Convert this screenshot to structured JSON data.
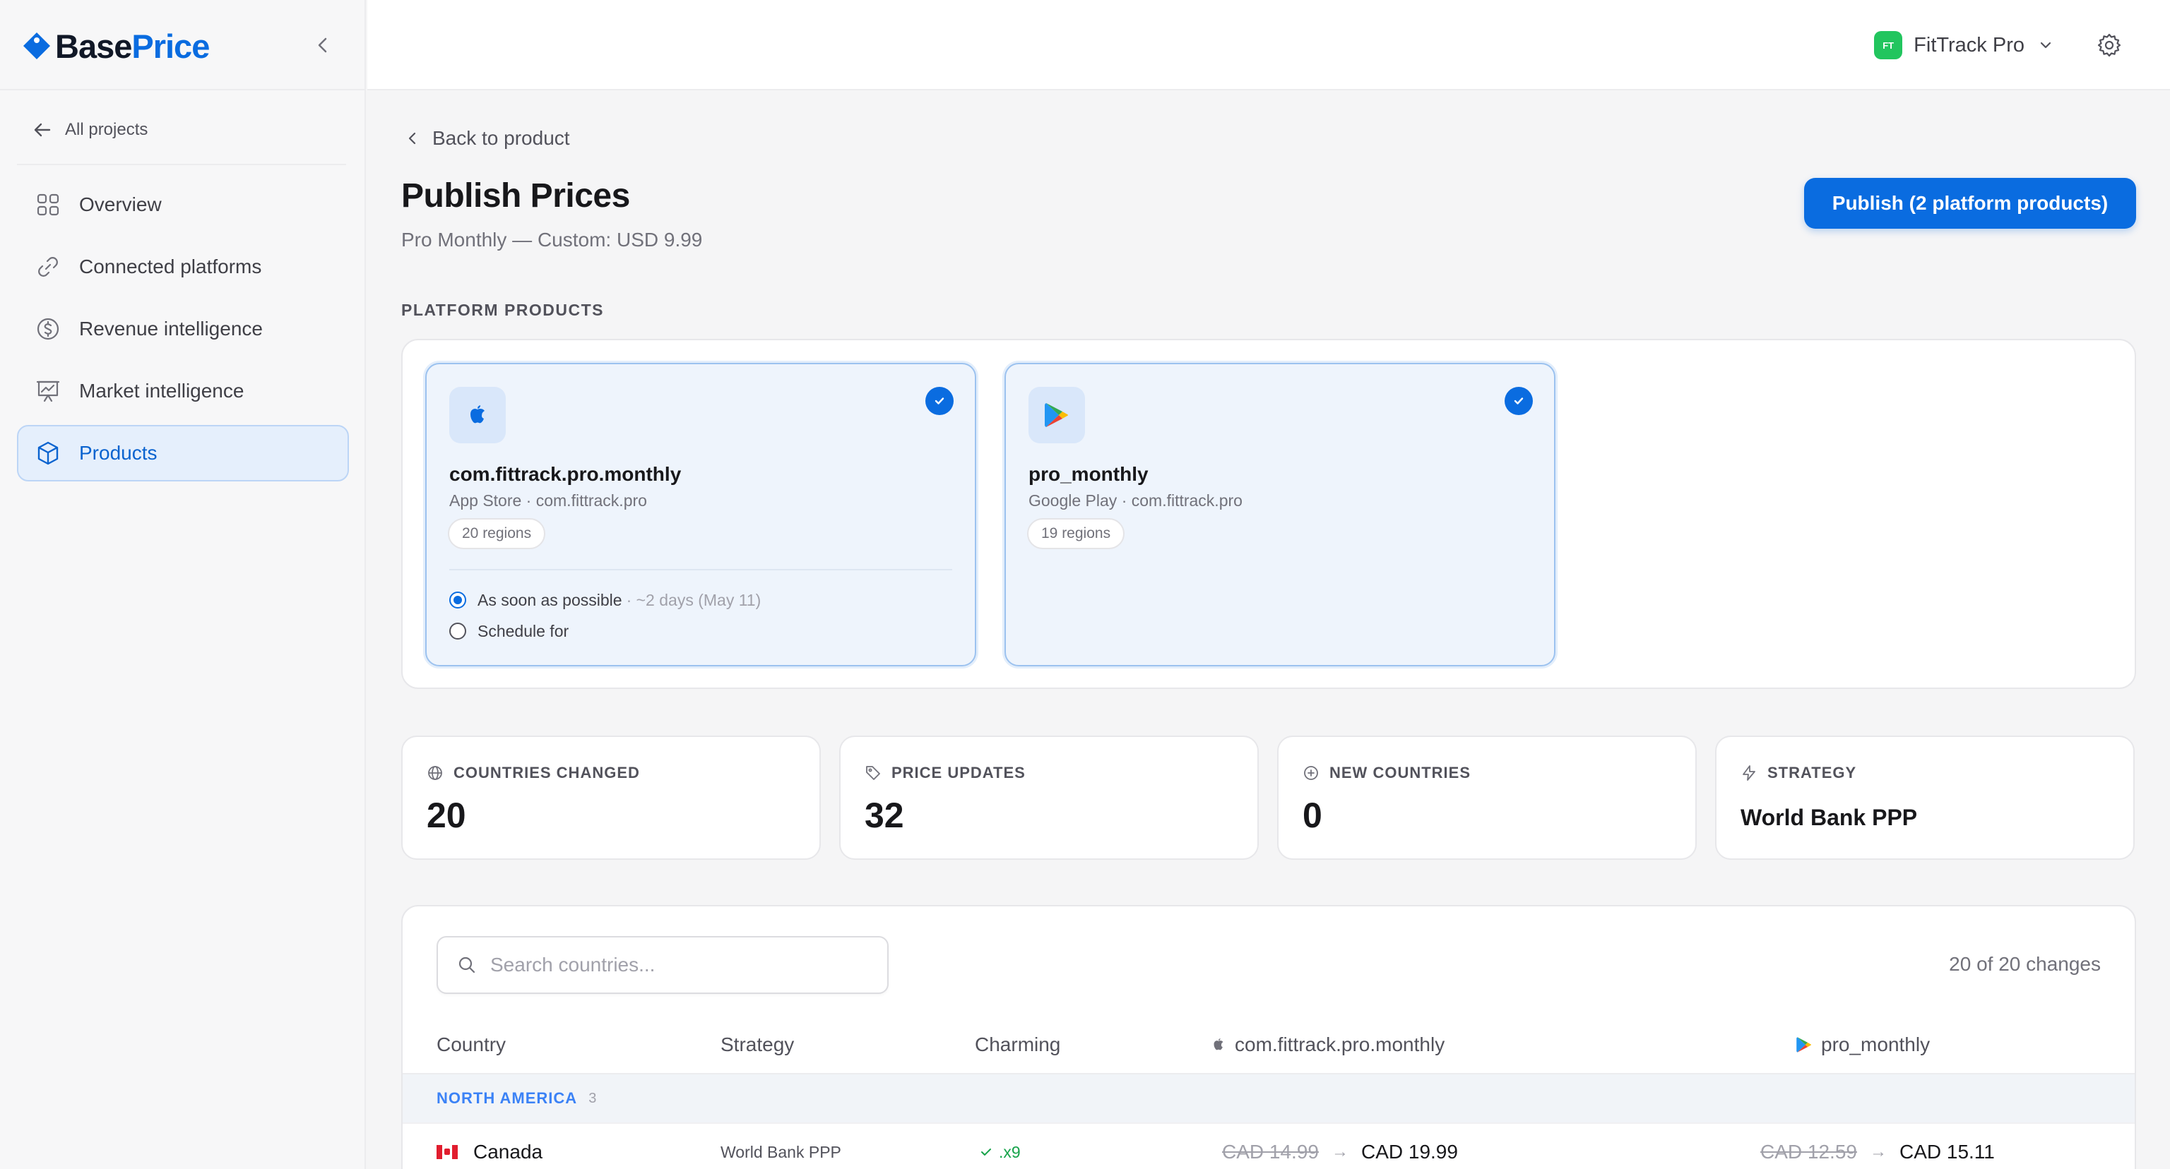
{
  "brand": {
    "name_part1": "Base",
    "name_part2": "Price"
  },
  "sidebar": {
    "back_label": "All projects",
    "items": [
      {
        "label": "Overview",
        "icon": "grid-icon"
      },
      {
        "label": "Connected platforms",
        "icon": "link-icon"
      },
      {
        "label": "Revenue intelligence",
        "icon": "dollar-icon"
      },
      {
        "label": "Market intelligence",
        "icon": "chart-board-icon"
      },
      {
        "label": "Products",
        "icon": "box-icon",
        "active": true
      }
    ]
  },
  "topbar": {
    "workspace_initials": "FT",
    "workspace_name": "FitTrack Pro"
  },
  "page": {
    "back_label": "Back to product",
    "title": "Publish Prices",
    "subtitle": "Pro Monthly — Custom: USD 9.99",
    "publish_label": "Publish (2 platform products)",
    "section_label": "PLATFORM PRODUCTS"
  },
  "platform_products": [
    {
      "name": "com.fittrack.pro.monthly",
      "sub": "App Store · com.fittrack.pro",
      "regions": "20 regions",
      "schedule": {
        "asap_label": "As soon as possible",
        "asap_hint": "· ~2 days (May 11)",
        "schedule_label": "Schedule for"
      }
    },
    {
      "name": "pro_monthly",
      "sub": "Google Play · com.fittrack.pro",
      "regions": "19 regions"
    }
  ],
  "stats": [
    {
      "label": "COUNTRIES CHANGED",
      "value": "20"
    },
    {
      "label": "PRICE UPDATES",
      "value": "32"
    },
    {
      "label": "NEW COUNTRIES",
      "value": "0"
    },
    {
      "label": "STRATEGY",
      "value": "World Bank PPP"
    }
  ],
  "table": {
    "search_placeholder": "Search countries...",
    "change_count": "20 of 20 changes",
    "headers": {
      "country": "Country",
      "strategy": "Strategy",
      "charming": "Charming",
      "appstore": "com.fittrack.pro.monthly",
      "googleplay": "pro_monthly"
    },
    "groups": [
      {
        "name": "NORTH AMERICA",
        "count": "3",
        "rows": [
          {
            "country": "Canada",
            "strategy": "World Bank PPP",
            "charming": ".x9",
            "appstore_old": "CAD 14.99",
            "appstore_new": "CAD 19.99",
            "googleplay_old": "CAD 12.59",
            "googleplay_new": "CAD 15.11"
          }
        ]
      }
    ]
  },
  "colors": {
    "accent": "#0a6ce0",
    "workspace_badge": "#22c55e",
    "success": "#16a34a"
  }
}
